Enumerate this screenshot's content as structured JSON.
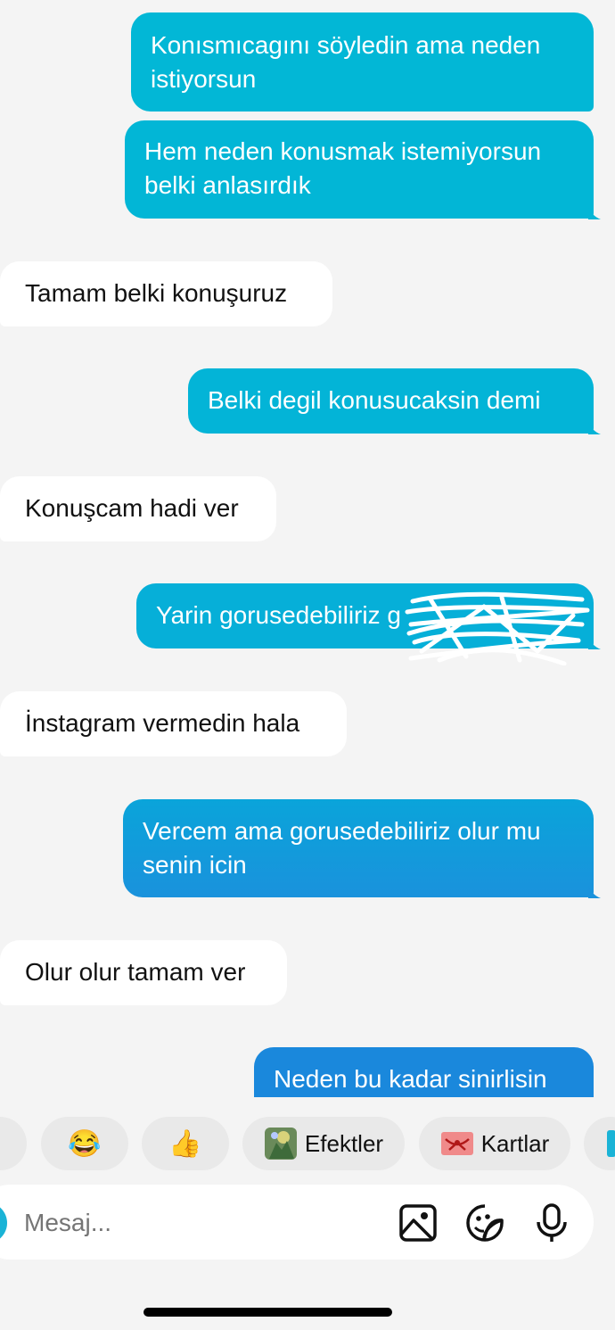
{
  "messages": [
    {
      "direction": "outgoing",
      "lines": [
        "Konısmıcagını söyledin ama neden",
        "istiyorsun"
      ]
    },
    {
      "direction": "outgoing",
      "lines": [
        "Hem neden konusmak istemiyorsun",
        "belki anlasırdık"
      ]
    },
    {
      "direction": "incoming",
      "lines": [
        "Tamam belki konuşuruz"
      ]
    },
    {
      "direction": "outgoing",
      "lines": [
        "Belki degil konusucaksin demi"
      ]
    },
    {
      "direction": "incoming",
      "lines": [
        "Konuşcam hadi ver"
      ]
    },
    {
      "direction": "outgoing",
      "lines": [
        "Yarin gorusedebiliriz g"
      ],
      "redacted": true
    },
    {
      "direction": "incoming",
      "lines": [
        "İnstagram vermedin hala"
      ]
    },
    {
      "direction": "outgoing",
      "lines": [
        "Vercem ama gorusedebiliriz olur mu",
        "senin icin"
      ]
    },
    {
      "direction": "incoming",
      "lines": [
        "Olur olur tamam ver"
      ]
    },
    {
      "direction": "outgoing",
      "lines": [
        "Neden bu kadar sinirlisin"
      ]
    }
  ],
  "quick_reactions": {
    "laugh": "😂",
    "thumbs_up": "👍",
    "effects_label": "Efektler",
    "cards_label": "Kartlar"
  },
  "composer": {
    "placeholder": "Mesaj...",
    "icons": [
      "gallery-icon",
      "sticker-icon",
      "microphone-icon"
    ]
  },
  "colors": {
    "outgoing_top": "#00b4d8",
    "outgoing_bottom": "#1a88dc",
    "incoming_bg": "#ffffff",
    "background": "#f4f4f4",
    "accent": "#1ab3d6"
  }
}
